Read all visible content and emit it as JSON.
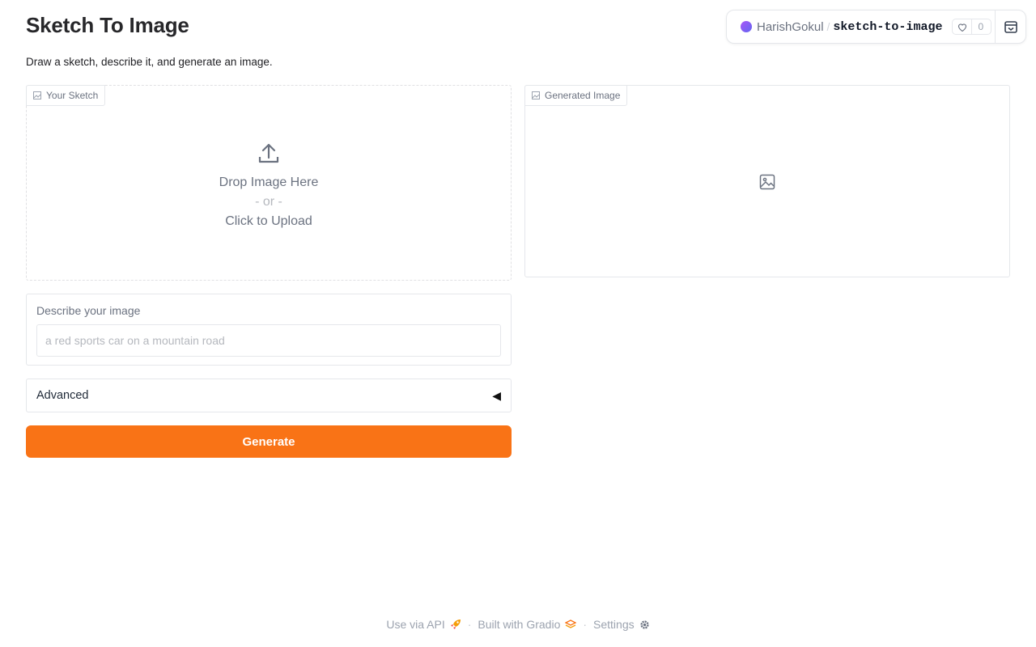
{
  "app": {
    "title": "Sketch To Image",
    "description": "Draw a sketch, describe it, and generate an image."
  },
  "hf_header": {
    "user": "HarishGokul",
    "separator": "/",
    "repo": "sketch-to-image",
    "likes": "0",
    "avatar_color": "#8b5cf6"
  },
  "sketch_panel": {
    "label": "Your Sketch",
    "drop_text": "Drop Image Here",
    "or_text": "- or -",
    "click_text": "Click to Upload"
  },
  "output_panel": {
    "label": "Generated Image"
  },
  "prompt": {
    "label": "Describe your image",
    "placeholder": "a red sports car on a mountain road",
    "value": ""
  },
  "advanced": {
    "label": "Advanced",
    "caret": "◀"
  },
  "generate": {
    "label": "Generate",
    "color": "#f97316"
  },
  "footer": {
    "api": "Use via API",
    "built": "Built with Gradio",
    "settings": "Settings",
    "separator": "·"
  }
}
